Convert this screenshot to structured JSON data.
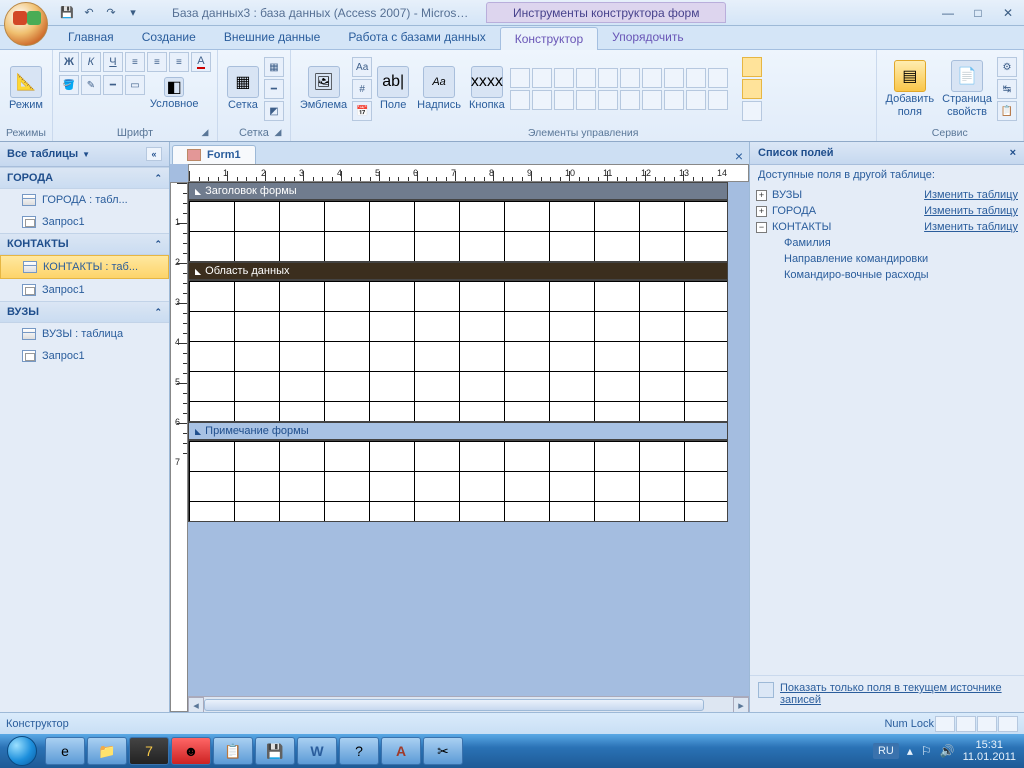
{
  "title": "База данных3 : база данных (Access 2007) - Microsof...",
  "contextual_tab_group": "Инструменты конструктора форм",
  "tabs": {
    "t0": "Главная",
    "t1": "Создание",
    "t2": "Внешние данные",
    "t3": "Работа с базами данных",
    "t4": "Конструктор",
    "t5": "Упорядочить"
  },
  "ribbon": {
    "g_modes": "Режимы",
    "mode_btn": "Режим",
    "g_font": "Шрифт",
    "cond_btn": "Условное",
    "g_grid": "Сетка",
    "grid_btn": "Сетка",
    "logo_btn": "Эмблема",
    "g_controls": "Элементы управления",
    "field_btn": "Поле",
    "label_btn": "Надпись",
    "button_btn": "Кнопка",
    "addfields_btn": "Добавить\nполя",
    "propsheet_btn": "Страница\nсвойств",
    "g_service": "Сервис"
  },
  "nav": {
    "header": "Все таблицы",
    "g1": "ГОРОДА",
    "i1a": "ГОРОДА : табл...",
    "i1b": "Запрос1",
    "g2": "КОНТАКТЫ",
    "i2a": "КОНТАКТЫ : таб...",
    "i2b": "Запрос1",
    "g3": "ВУЗЫ",
    "i3a": "ВУЗЫ : таблица",
    "i3b": "Запрос1"
  },
  "doc": {
    "tab": "Form1"
  },
  "sections": {
    "header": "Заголовок формы",
    "detail": "Область данных",
    "footer": "Примечание формы"
  },
  "fieldlist": {
    "title": "Список полей",
    "subtitle": "Доступные поля в другой таблице:",
    "t1": "ВУЗЫ",
    "l1": "Изменить таблицу",
    "t2": "ГОРОДА",
    "l2": "Изменить таблицу",
    "t3": "КОНТАКТЫ",
    "l3": "Изменить таблицу",
    "c1": "Фамилия",
    "c2": "Направление командировки",
    "c3": "Командиро-вочные расходы",
    "footer": "Показать только поля в текущем источнике записей"
  },
  "status": {
    "mode": "Конструктор",
    "numlock": "Num Lock"
  },
  "taskbar": {
    "lang": "RU",
    "time": "15:31",
    "date": "11.01.2011"
  }
}
